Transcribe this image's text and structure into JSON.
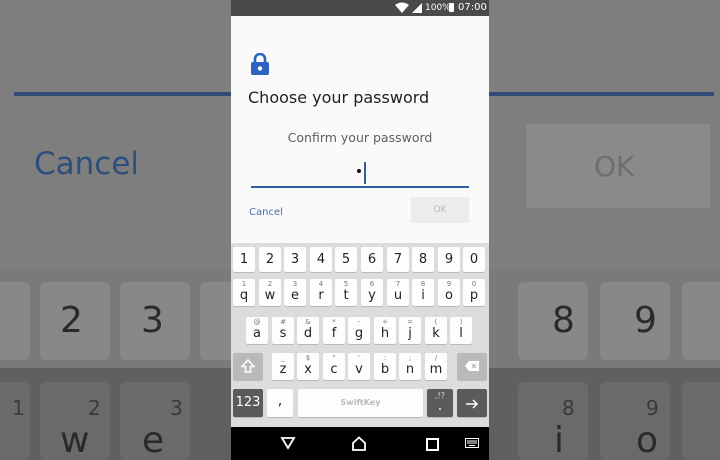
{
  "status_bar": {
    "battery": "100%",
    "time": "07:00"
  },
  "dialog": {
    "title": "Choose your password",
    "subtitle": "Confirm your password",
    "cancel_label": "Cancel",
    "ok_label": "OK"
  },
  "keyboard": {
    "number_row": [
      "1",
      "2",
      "3",
      "4",
      "5",
      "6",
      "7",
      "8",
      "9",
      "0"
    ],
    "row1": [
      {
        "main": "q",
        "alt": "1"
      },
      {
        "main": "w",
        "alt": "2"
      },
      {
        "main": "e",
        "alt": "3"
      },
      {
        "main": "r",
        "alt": "4"
      },
      {
        "main": "t",
        "alt": "5"
      },
      {
        "main": "y",
        "alt": "6"
      },
      {
        "main": "u",
        "alt": "7"
      },
      {
        "main": "i",
        "alt": "8"
      },
      {
        "main": "o",
        "alt": "9"
      },
      {
        "main": "p",
        "alt": "0"
      }
    ],
    "row2": [
      {
        "main": "a",
        "alt": "@"
      },
      {
        "main": "s",
        "alt": "#"
      },
      {
        "main": "d",
        "alt": "&"
      },
      {
        "main": "f",
        "alt": "*"
      },
      {
        "main": "g",
        "alt": "-"
      },
      {
        "main": "h",
        "alt": "+"
      },
      {
        "main": "j",
        "alt": "="
      },
      {
        "main": "k",
        "alt": "("
      },
      {
        "main": "l",
        "alt": ")"
      }
    ],
    "row3": [
      {
        "main": "z",
        "alt": "_"
      },
      {
        "main": "x",
        "alt": "$"
      },
      {
        "main": "c",
        "alt": "\""
      },
      {
        "main": "v",
        "alt": "'"
      },
      {
        "main": "b",
        "alt": ":"
      },
      {
        "main": "n",
        "alt": ";"
      },
      {
        "main": "m",
        "alt": "/"
      }
    ],
    "symbols_label": "123",
    "comma_label": ",",
    "space_label": "SwiftKey",
    "period_label": ".",
    "period_alt": ",!?"
  },
  "colors": {
    "accent": "#2f5f9e",
    "lock": "#2c62c0"
  }
}
